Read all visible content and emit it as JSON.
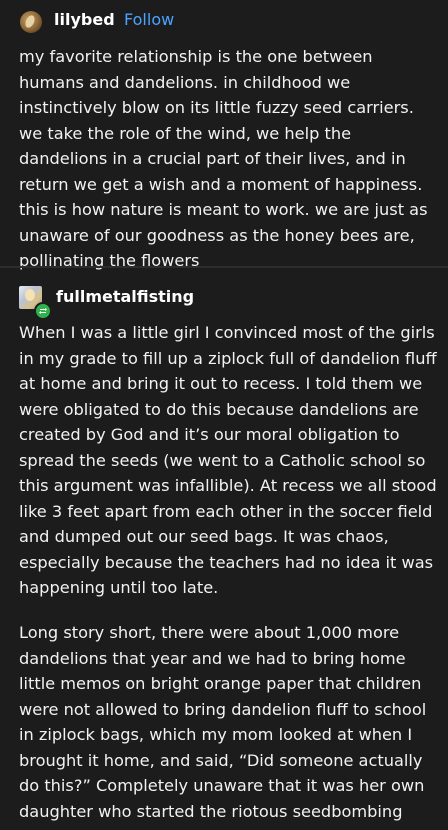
{
  "post": {
    "author": "lilybed",
    "follow_label": "Follow",
    "text": "my favorite relationship is the one between humans and dandelions. in childhood we instinctively blow on its little fuzzy seed carriers. we take the role of the wind, we help the dandelions in a crucial part of their lives, and in return we get a wish and a moment of happiness. this is how nature is meant to work. we are just as unaware of our goodness as the honey bees are, pollinating the flowers"
  },
  "reblog": {
    "author": "fullmetalfisting",
    "badge_icon": "reblog-icon",
    "badge_color": "#2fb24c",
    "paragraphs": [
      "When I was a little girl I convinced most of the girls in my grade to fill up a ziplock full of dandelion fluff at home and bring it out to recess. I told them we were obligated to do this because dandelions are created by God and it’s our moral obligation to spread the seeds (we went to a Catholic school so this argument was infallible). At recess we all stood like 3 feet apart from each other in the soccer field and dumped out our seed bags. It was chaos, especially because the teachers had no idea it was happening until too late.",
      "Long story short, there were about 1,000 more dandelions that year and we had to bring home little memos on bright orange paper that children were not allowed to bring dandelion fluff to school in ziplock bags, which my mom looked at when I brought it home, and said, “Did someone actually do this?” Completely unaware that it was her own daughter who started the riotous seedbombing"
    ]
  },
  "colors": {
    "background": "#1c1c1c",
    "text": "#f2f2f2",
    "link": "#4aa3ff"
  }
}
